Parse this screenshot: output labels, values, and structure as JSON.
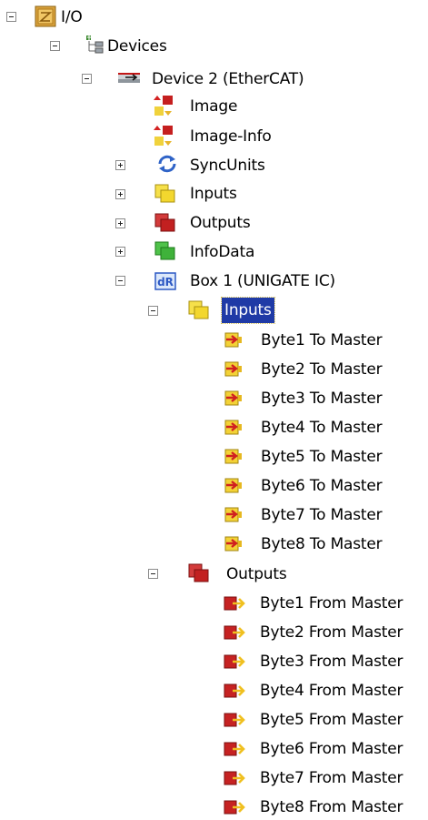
{
  "tree": {
    "io": "I/O",
    "devices": "Devices",
    "device2": "Device 2 (EtherCAT)",
    "image": "Image",
    "image_info": "Image-Info",
    "syncunits": "SyncUnits",
    "inputs": "Inputs",
    "outputs": "Outputs",
    "infodata": "InfoData",
    "box1": "Box 1 (UNIGATE IC)",
    "box_inputs": "Inputs",
    "box_outputs": "Outputs",
    "in_vars": [
      "Byte1 To Master",
      "Byte2 To Master",
      "Byte3 To Master",
      "Byte4 To Master",
      "Byte5 To Master",
      "Byte6 To Master",
      "Byte7 To Master",
      "Byte8 To Master"
    ],
    "out_vars": [
      "Byte1 From Master",
      "Byte2 From Master",
      "Byte3 From Master",
      "Byte4 From Master",
      "Byte5 From Master",
      "Byte6 From Master",
      "Byte7 From Master",
      "Byte8 From Master"
    ]
  }
}
